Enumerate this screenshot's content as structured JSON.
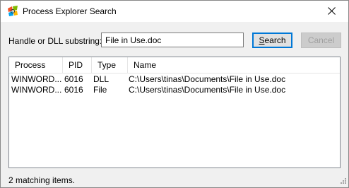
{
  "window": {
    "title": "Process Explorer Search"
  },
  "search": {
    "label": "Handle or DLL substring:",
    "value": "File in Use.doc",
    "search_button_label": "Search",
    "search_button_accesskey": "S",
    "search_button_rest": "earch",
    "cancel_button_label": "Cancel"
  },
  "results": {
    "columns": [
      "Process",
      "PID",
      "Type",
      "Name"
    ],
    "sort_column": "PID",
    "rows": [
      {
        "process": "WINWORD....",
        "pid": "6016",
        "type": "DLL",
        "name": "C:\\Users\\tinas\\Documents\\File in Use.doc"
      },
      {
        "process": "WINWORD....",
        "pid": "6016",
        "type": "File",
        "name": "C:\\Users\\tinas\\Documents\\File in Use.doc"
      }
    ]
  },
  "status": {
    "text": "2 matching items."
  },
  "colors": {
    "focus_border": "#0078d7",
    "window_bg": "#f0f0f0"
  }
}
